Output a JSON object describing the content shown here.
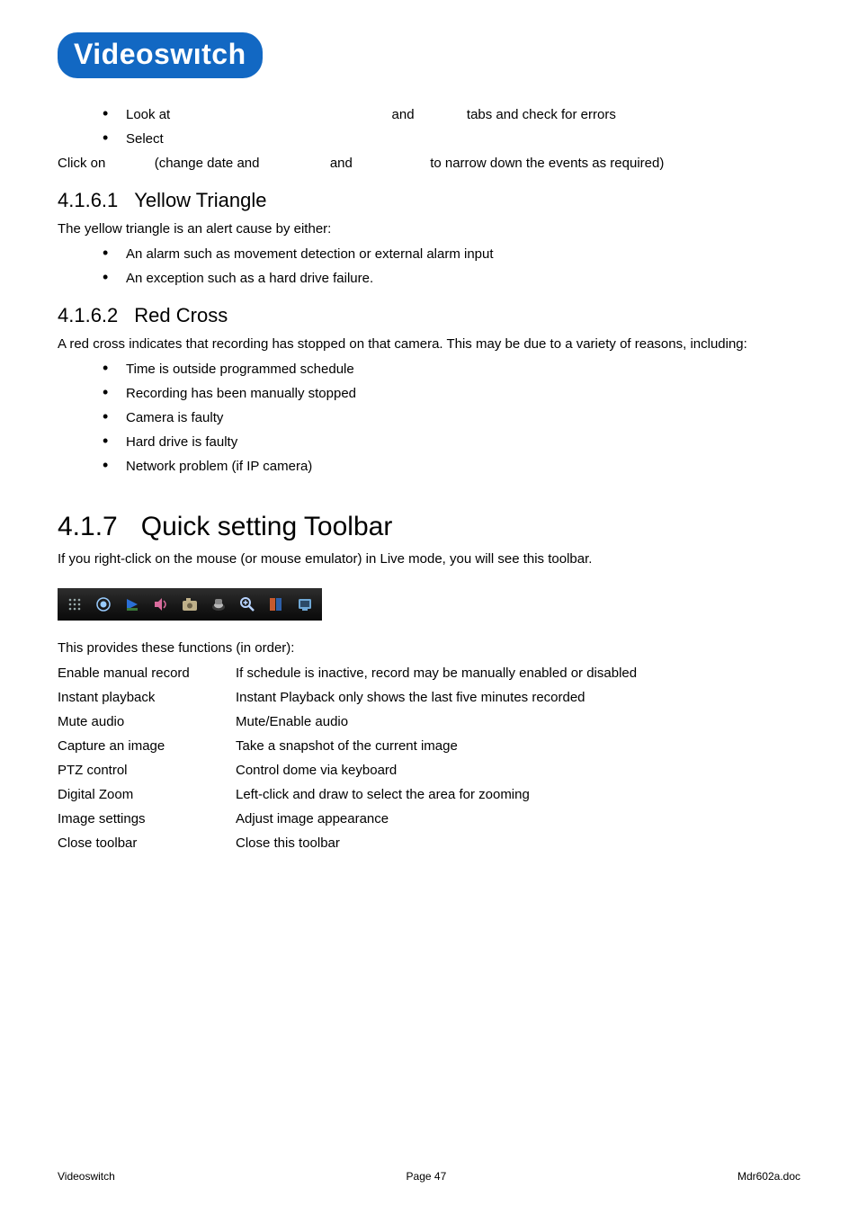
{
  "header": {
    "logo_text": "Videoswıtch"
  },
  "intro": {
    "bullets_first": [
      {
        "pre": "Look at ",
        "mid": " and ",
        "post": " tabs and check for errors",
        "_note_gap1": 210,
        "_note_gap2": 36
      },
      {
        "text": "Select"
      }
    ],
    "clickon": {
      "p1": "Click  on ",
      "p2": " (change  date  and ",
      "p3": " and ",
      "p4": " to  narrow  down  the  events  as required)"
    }
  },
  "sections": {
    "yellow": {
      "num": "4.1.6.1",
      "title": "Yellow Triangle",
      "lead": "The yellow triangle is an alert cause by either:",
      "bullets": [
        "An alarm such as movement detection or external alarm input",
        "An exception such as a hard drive failure."
      ]
    },
    "red": {
      "num": "4.1.6.2",
      "title": "Red Cross",
      "lead": "A red cross indicates that recording has stopped on that camera. This may be due to a variety of reasons, including:",
      "bullets": [
        "Time is outside programmed schedule",
        "Recording has been manually stopped",
        "Camera is faulty",
        "Hard drive is faulty",
        "Network problem (if IP camera)"
      ]
    },
    "quick": {
      "num": "4.1.7",
      "title": "Quick setting Toolbar",
      "lead": "If you right-click on the mouse (or mouse emulator) in Live mode, you will see this toolbar.",
      "provides": "This provides these functions (in order):",
      "functions": [
        {
          "k": "Enable manual record",
          "v": "If schedule is inactive, record may be manually enabled or disabled"
        },
        {
          "k": "Instant playback",
          "v": "Instant Playback only shows the last five minutes recorded"
        },
        {
          "k": "Mute audio",
          "v": "Mute/Enable audio"
        },
        {
          "k": "Capture an image",
          "v": "Take a snapshot of the current image"
        },
        {
          "k": "PTZ control",
          "v": "Control dome via keyboard"
        },
        {
          "k": "Digital Zoom",
          "v": "Left-click and draw to select the area for zooming"
        },
        {
          "k": "Image settings",
          "v": "Adjust image appearance"
        },
        {
          "k": "Close toolbar",
          "v": "Close this toolbar"
        }
      ]
    }
  },
  "footer": {
    "left": "Videoswitch",
    "center": "Page 47",
    "right": "Mdr602a.doc"
  }
}
